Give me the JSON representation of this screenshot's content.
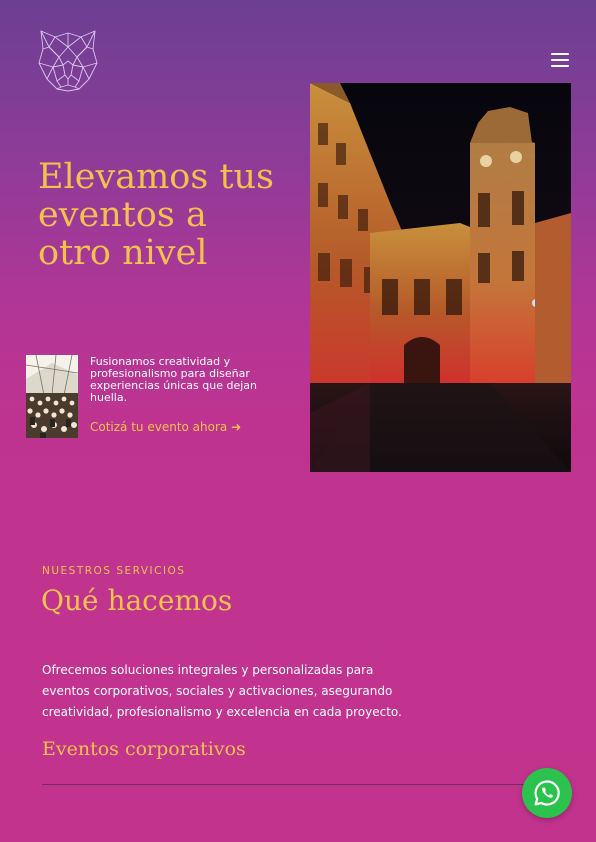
{
  "brand": {
    "logo_icon": "panther-head-icon",
    "accent_color": "#f2c14e"
  },
  "header": {
    "menu_icon": "hamburger-menu-icon"
  },
  "hero": {
    "title_lines": [
      "Elevamos tus",
      "eventos a",
      "otro nivel"
    ],
    "photo": "illuminated-historic-building-night-photo",
    "thumbnail": "event-audience-hall-photo",
    "intro_lines": [
      "Fusionamos creatividad y",
      "profesionalismo para diseñar",
      "experiencias únicas que dejan",
      "huella."
    ],
    "cta_label": "Cotizá tu evento ahora",
    "cta_arrow": "➜"
  },
  "services": {
    "kicker": "NUESTROS SERVICIOS",
    "title": "Qué hacemos",
    "body_lines": [
      "Ofrecemos soluciones integrales y personalizadas para",
      "eventos corporativos, sociales y activaciones, asegurando",
      "creatividad, profesionalismo y excelencia en cada proyecto."
    ],
    "items": [
      "Eventos corporativos"
    ]
  },
  "floating": {
    "whatsapp_icon": "whatsapp-icon",
    "whatsapp_color": "#2bc24d"
  }
}
